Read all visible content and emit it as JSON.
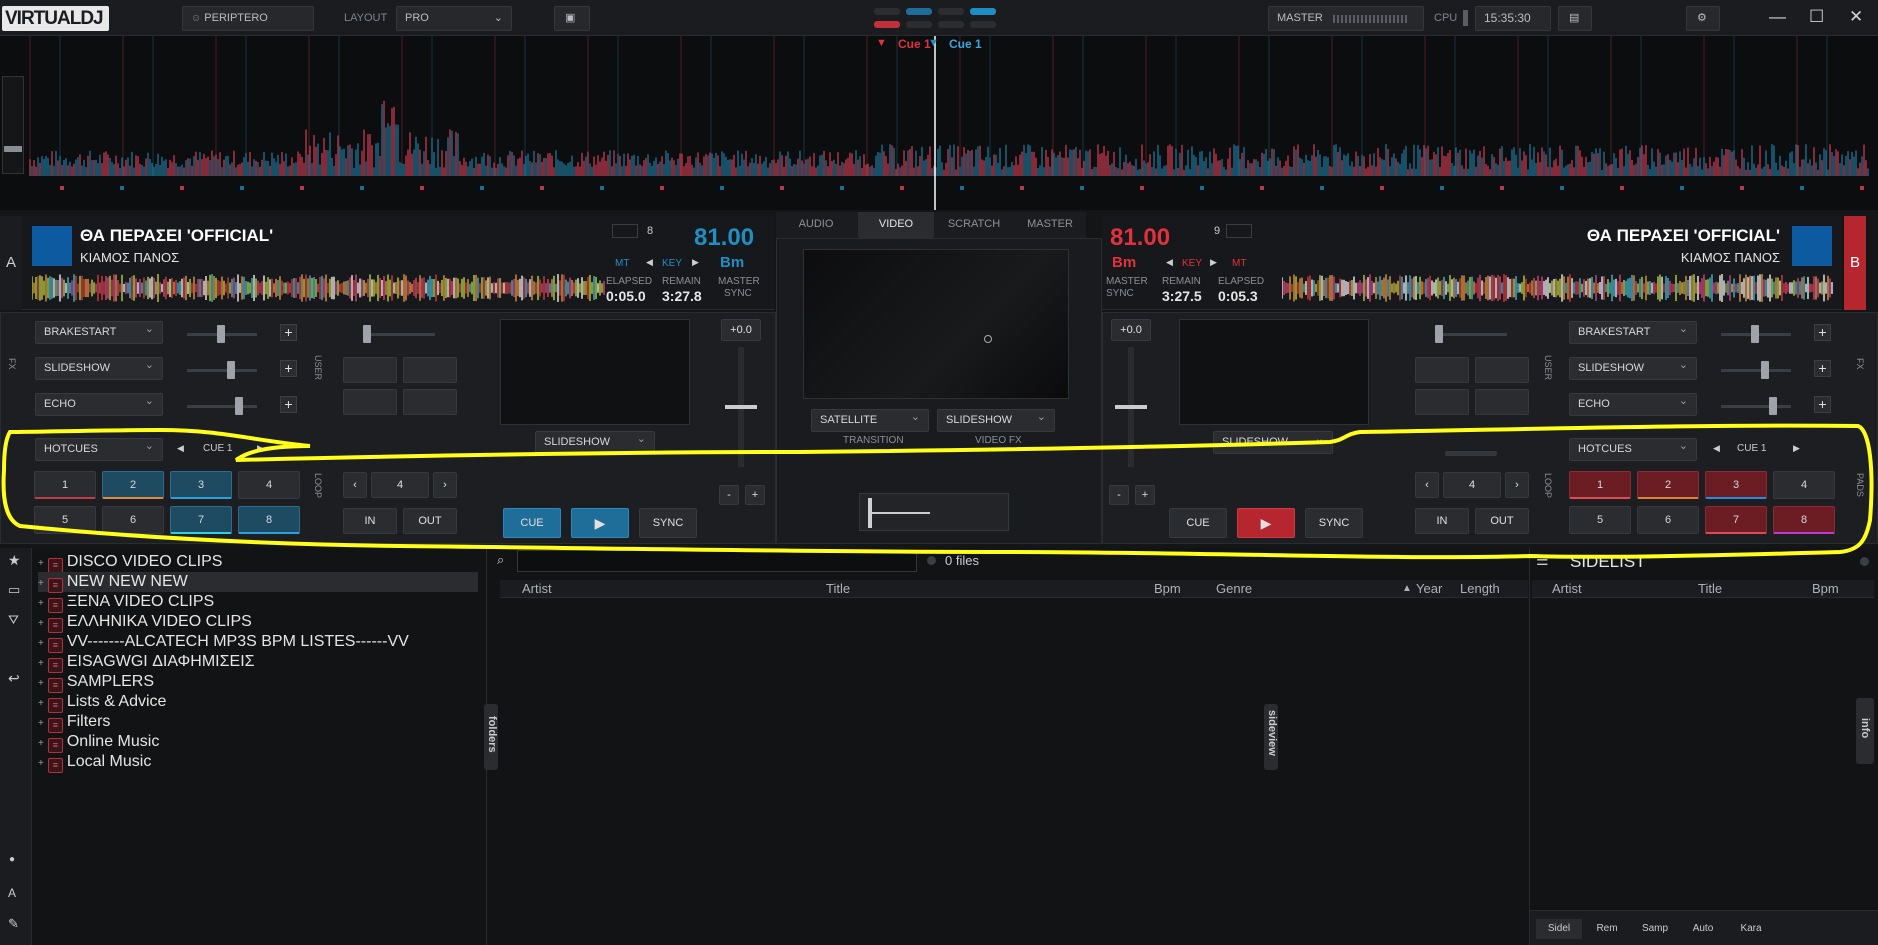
{
  "topbar": {
    "logo": "VIRTUALDJ",
    "user": "PERIPTERO",
    "layout_label": "LAYOUT",
    "layout_value": "PRO",
    "master_label": "MASTER",
    "cpu_label": "CPU",
    "clock": "15:35:30"
  },
  "overview": {
    "cue_red": "Cue 1",
    "cue_blue": "Cue 1"
  },
  "deckA": {
    "letter": "A",
    "title": "ΘΑ ΠΕΡΑΣΕΙ 'OFFICIAL'",
    "artist": "ΚΙΑΜΟΣ ΠΑΝΟΣ",
    "loop_count": "8",
    "bpm": "81.00",
    "mt": "MT",
    "key_label": "KEY",
    "key_value": "Bm",
    "elapsed_label": "ELAPSED",
    "elapsed": "0:05.0",
    "remain_label": "REMAIN",
    "remain": "3:27.8",
    "master_label": "MASTER",
    "sync_label": "SYNC",
    "fx": [
      "BRAKESTART",
      "SLIDESHOW",
      "ECHO"
    ],
    "fx_side": "FX",
    "user_side": "USER",
    "video_fx": "SLIDESHOW",
    "pitch": "+0.0",
    "hotcues_mode": "HOTCUES",
    "cue_sel": "CUE 1",
    "pads": [
      "1",
      "2",
      "3",
      "4",
      "5",
      "6",
      "7",
      "8"
    ],
    "loop_side": "LOOP",
    "loop_size": "4",
    "in": "IN",
    "out": "OUT",
    "cue": "CUE",
    "sync": "SYNC",
    "minus": "-",
    "plus": "+"
  },
  "deckB": {
    "letter": "B",
    "title": "ΘΑ ΠΕΡΑΣΕΙ 'OFFICIAL'",
    "artist": "ΚΙΑΜΟΣ ΠΑΝΟΣ",
    "loop_count": "9",
    "bpm": "81.00",
    "mt": "MT",
    "key_label": "KEY",
    "key_value": "Bm",
    "elapsed_label": "ELAPSED",
    "elapsed": "0:05.3",
    "remain_label": "REMAIN",
    "remain": "3:27.5",
    "master_label": "MASTER",
    "sync_label": "SYNC",
    "fx": [
      "BRAKESTART",
      "SLIDESHOW",
      "ECHO"
    ],
    "fx_side": "FX",
    "user_side": "USER",
    "video_fx": "SLIDESHOW",
    "pitch": "+0.0",
    "hotcues_mode": "HOTCUES",
    "cue_sel": "CUE 1",
    "pads": [
      "1",
      "2",
      "3",
      "4",
      "5",
      "6",
      "7",
      "8"
    ],
    "loop_side": "LOOP",
    "pads_side": "PADS",
    "loop_size": "4",
    "in": "IN",
    "out": "OUT",
    "cue": "CUE",
    "sync": "SYNC",
    "minus": "-",
    "plus": "+"
  },
  "center": {
    "tabs": [
      "AUDIO",
      "VIDEO",
      "SCRATCH",
      "MASTER"
    ],
    "active_tab": "VIDEO",
    "transition": "SATELLITE",
    "transition_label": "TRANSITION",
    "videofx": "SLIDESHOW",
    "videofx_label": "VIDEO FX"
  },
  "browser": {
    "tree": [
      "DISCO VIDEO CLIPS",
      "NEW NEW NEW",
      "ΞΕΝΑ VIDEO CLIPS",
      "ΕΛΛΗΝΙΚΑ VIDEO CLIPS",
      "VV-------ALCATECH MP3S BPM LISTES------VV",
      "EISAGWGI ΔΙΑΦΗΜΙΣΕΙΣ",
      "SAMPLERS",
      "Lists & Advice",
      "Filters",
      "Online Music",
      "Local Music"
    ],
    "selected": "NEW NEW NEW",
    "folders_tab": "folders",
    "search_placeholder": "",
    "files_count": "0 files",
    "columns": [
      "Artist",
      "Title",
      "Bpm",
      "Genre",
      "Year",
      "Length"
    ],
    "sideview_tab": "sideview",
    "sidelist_title": "SIDELIST",
    "sidelist_columns": [
      "Artist",
      "Title",
      "Bpm"
    ],
    "info_tab": "info",
    "bottom_tabs": [
      "Sidel",
      "Rem",
      "Samp",
      "Auto",
      "Kara"
    ]
  },
  "colors": {
    "deckA_accent": "#1e8fc4",
    "deckB_accent": "#c4303a",
    "annotation": "#ffff1a"
  }
}
